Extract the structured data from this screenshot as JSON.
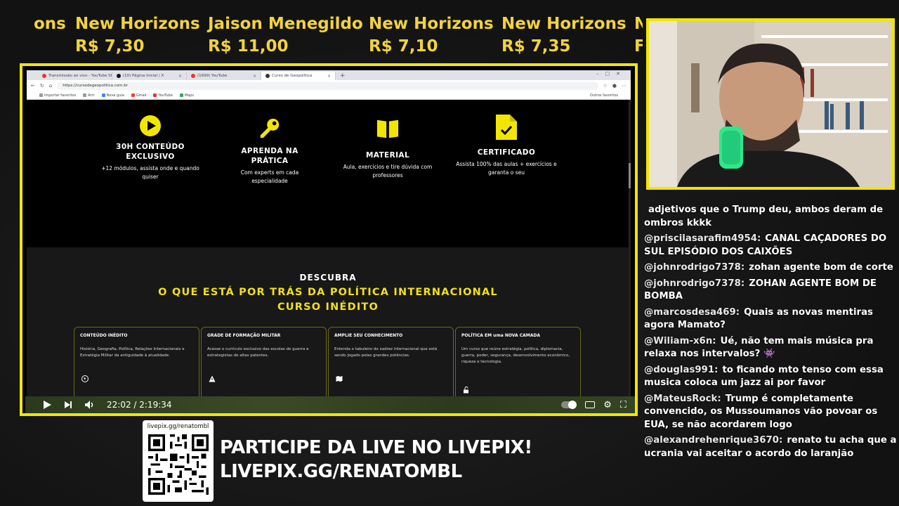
{
  "ticker": [
    {
      "name": "ons",
      "value": ""
    },
    {
      "name": "New Horizons",
      "value": "R$ 7,30"
    },
    {
      "name": "Jaison Menegildo",
      "value": "R$ 11,00"
    },
    {
      "name": "New Horizons",
      "value": "R$ 7,10"
    },
    {
      "name": "New Horizons",
      "value": "R$ 7,35"
    },
    {
      "name": "N",
      "value": "F"
    }
  ],
  "browser": {
    "tabs": [
      {
        "label": "Transmissão ao vivo - YouTube St",
        "color": "#e33"
      },
      {
        "label": "(10) Página Inicial / X",
        "color": "#111"
      },
      {
        "label": "(1699) YouTube",
        "color": "#e33"
      },
      {
        "label": "Curso de Geopolítica",
        "color": "#333"
      }
    ],
    "new_tab": "+",
    "url": "https://cursodegeopolitica.com.br",
    "bookmarks": [
      "Importar favoritos",
      "Arrr",
      "Nova guia",
      "Gmail",
      "YouTube",
      "Maps"
    ],
    "bookmarks_right": "Outros favoritos"
  },
  "site": {
    "features": [
      {
        "title": "30H CONTEÚDO EXCLUSIVO",
        "desc": "+12 módulos, assista onde e quando quiser",
        "icon": "play-icon"
      },
      {
        "title": "APRENDA NA PRÁTICA",
        "desc": "Com experts em cada especialidade",
        "icon": "key-icon"
      },
      {
        "title": "MATERIAL",
        "desc": "Aula, exercícios e tire dúvida com professores",
        "icon": "book-icon"
      },
      {
        "title": "CERTIFICADO",
        "desc": "Assista 100% das aulas + exercícios e garanta o seu",
        "icon": "certificate-icon"
      }
    ],
    "discover": "DESCUBRA",
    "headline1": "O QUE ESTÁ POR TRÁS DA POLÍTICA INTERNACIONAL",
    "headline2": "CURSO INÉDITO",
    "cards": [
      {
        "title": "CONTEÚDO INÉDITO",
        "desc": "História, Geografia, Política, Relações Internacionais e Estratégia Militar da antiguidade à atualidade.",
        "icon": "globe-icon"
      },
      {
        "title": "GRADE DE FORMAÇÃO MILITAR",
        "desc": "Acesse o currículo exclusivo das escolas de guerra e estrategistas de altas patentes.",
        "icon": "warning-icon"
      },
      {
        "title": "AMPLIE SEU CONHECIMENTO",
        "desc": "Entenda o tabuleiro do xadrez internacional que está sendo jogado pelas grandes potências.",
        "icon": "map-icon"
      },
      {
        "title": "POLÍTICA EM uma NOVA CAMADA",
        "desc": "Um curso que reúne estratégia, política, diplomacia, guerra, poder, segurança, desenvolvimento econômico, riqueza e tecnologia.",
        "icon": "unlock-icon"
      }
    ]
  },
  "player": {
    "time": "22:02 / 2:19:34"
  },
  "chat": [
    {
      "user": "",
      "text": "adjetivos que o Trump deu, ambos deram de ombros kkkk"
    },
    {
      "user": "@priscilasarafim4954:",
      "text": "CANAL CAÇADORES DO SUL EPISÓDIO DOS CAIXÕES"
    },
    {
      "user": "@johnrodrigo7378:",
      "text": "zohan agente bom de corte"
    },
    {
      "user": "@johnrodrigo7378:",
      "text": "ZOHAN AGENTE BOM DE BOMBA"
    },
    {
      "user": "@marcosdesa469:",
      "text": "Quais as novas mentiras agora Mamato?"
    },
    {
      "user": "@Wiliam-x6n:",
      "text": "Ué, não tem mais música pra relaxa nos intervalos? 👾"
    },
    {
      "user": "@douglas991:",
      "text": "to ficando mto tenso com essa musica coloca um jazz ai por favor"
    },
    {
      "user": "@MateusRock:",
      "text": "Trump é completamente convencido, os Mussoumanos vão povoar os EUA, se não acordarem logo"
    },
    {
      "user": "@alexandrehenrique3670:",
      "text": "renato tu acha que a ucrania vai aceitar o acordo do laranjão"
    }
  ],
  "livepix": {
    "url": "livepix.gg/renatombl",
    "cta_line1": "PARTICIPE DA LIVE NO LIVEPIX!",
    "cta_line2": "LIVEPIX.GG/RENATOMBL"
  },
  "colors": {
    "accent": "#f2e600",
    "ticker": "#f2d33b",
    "headline": "#f2e01a"
  }
}
